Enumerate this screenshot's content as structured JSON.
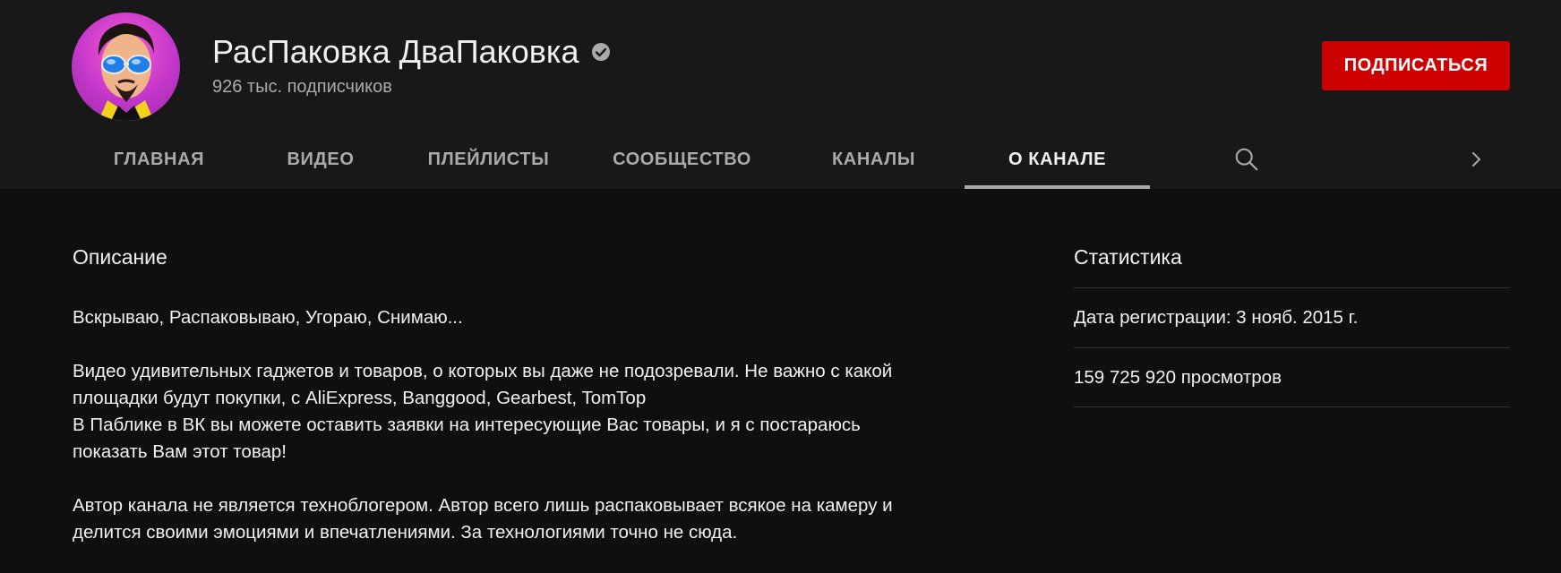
{
  "channel": {
    "name": "РасПаковка ДваПаковка",
    "subscribers": "926 тыс. подписчиков",
    "verified_icon": "verified-check-icon"
  },
  "subscribe_button": {
    "label": "ПОДПИСАТЬСЯ",
    "color": "#cc0000"
  },
  "tabs": [
    {
      "label": "ГЛАВНАЯ",
      "active": false
    },
    {
      "label": "ВИДЕО",
      "active": false
    },
    {
      "label": "ПЛЕЙЛИСТЫ",
      "active": false
    },
    {
      "label": "СООБЩЕСТВО",
      "active": false
    },
    {
      "label": "КАНАЛЫ",
      "active": false
    },
    {
      "label": "О КАНАЛЕ",
      "active": true
    }
  ],
  "tab_icons": {
    "search": "search-icon",
    "next": "chevron-right-icon"
  },
  "description": {
    "title": "Описание",
    "paragraphs": [
      [
        "Вскрываю, Распаковываю, Угораю, Снимаю..."
      ],
      [
        "Видео удивительных гаджетов и товаров, о которых вы даже не подозревали. Не важно с какой",
        "площадки будут покупки, с AliExpress, Banggood, Gearbest, TomTop",
        "В Паблике в ВК вы можете оставить заявки на интересующие Вас товары, и я с постараюсь",
        "показать Вам этот товар!"
      ],
      [
        "Автор канала не является техноблогером. Автор всего лишь распаковывает всякое на камеру и",
        "делится своими эмоциями и впечатлениями. За технологиями точно не сюда."
      ]
    ]
  },
  "stats": {
    "title": "Статистика",
    "registration": "Дата регистрации: 3 нояб. 2015 г.",
    "views": "159 725 920 просмотров"
  }
}
